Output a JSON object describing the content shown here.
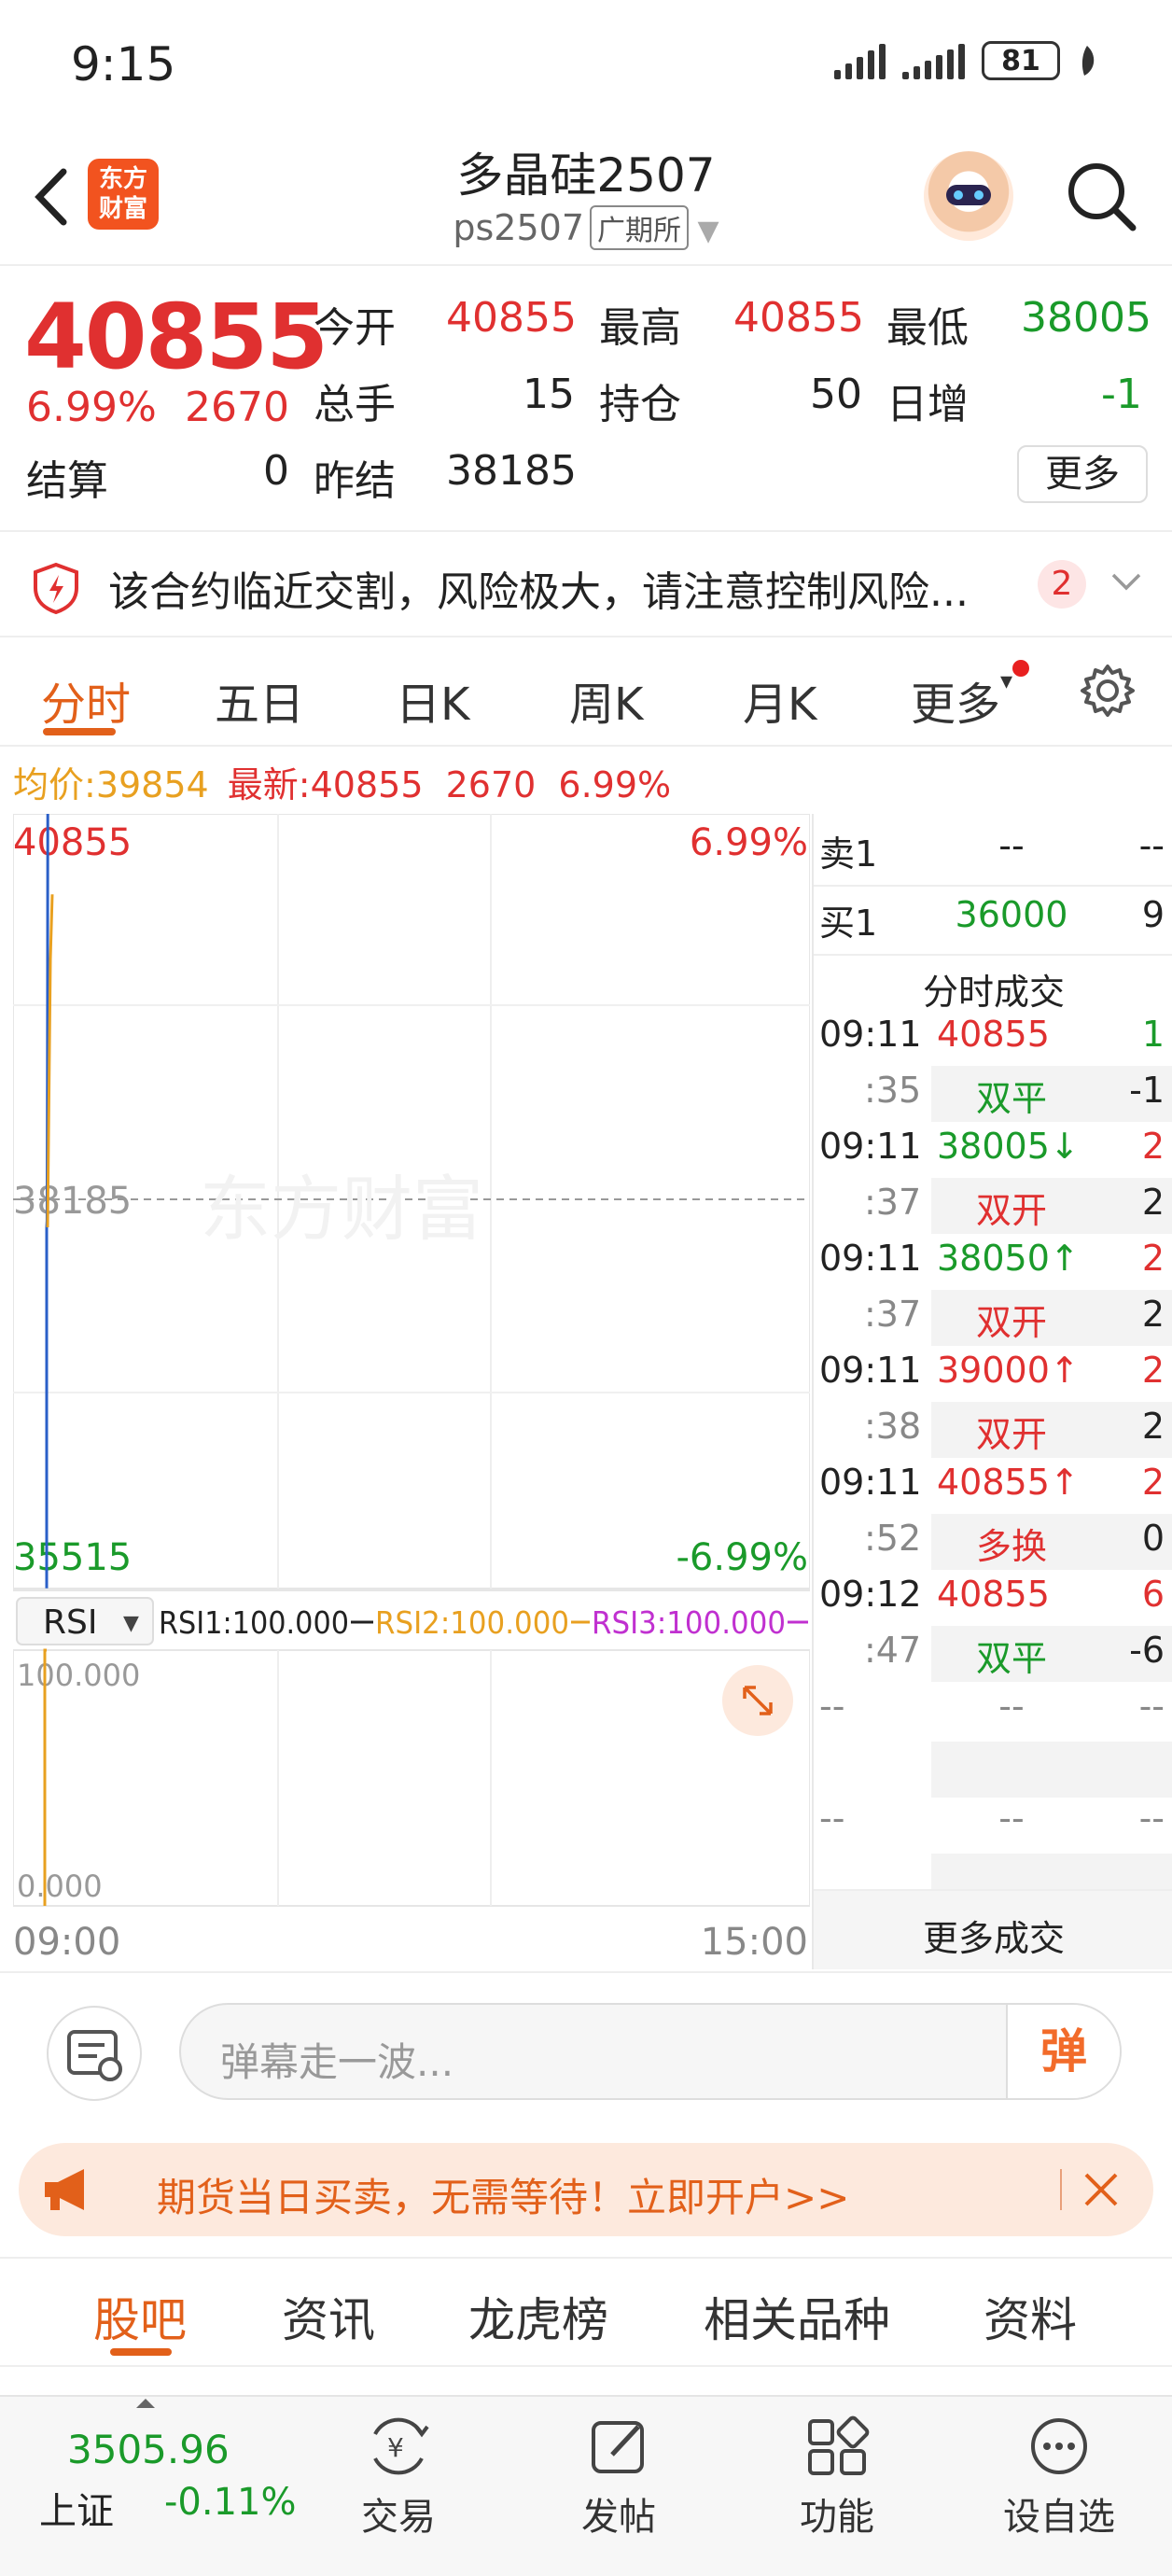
{
  "status": {
    "time": "9:15",
    "battery": "81"
  },
  "header": {
    "title": "多晶硅2507",
    "code": "ps2507",
    "exchange": "广期所",
    "logo_line1": "东方",
    "logo_line2": "财富"
  },
  "quote": {
    "price": "40855",
    "change_pct": "6.99%",
    "change": "2670",
    "open_label": "今开",
    "open": "40855",
    "high_label": "最高",
    "high": "40855",
    "low_label": "最低",
    "low": "38005",
    "volume_label": "总手",
    "volume": "15",
    "oi_label": "持仓",
    "oi": "50",
    "daily_inc_label": "日增",
    "daily_inc": "-1",
    "settle_label": "结算",
    "settle": "0",
    "prev_settle_label": "昨结",
    "prev_settle": "38185",
    "more_label": "更多"
  },
  "notice": {
    "text": "该合约临近交割，风险极大，请注意控制风险...",
    "count": "2"
  },
  "tabs": [
    "分时",
    "五日",
    "日K",
    "周K",
    "月K",
    "更多"
  ],
  "infoline": {
    "avg_label": "均价:",
    "avg": "39854",
    "latest_label": "最新:",
    "latest": "40855",
    "change": "2670",
    "pct": "6.99%"
  },
  "chart": {
    "upper_price": "40855",
    "upper_pct": "6.99%",
    "mid_price": "38185",
    "lower_price": "35515",
    "lower_pct": "-6.99%",
    "watermark": "东方财富",
    "indicator": "RSI",
    "rsi1": "RSI1:100.000",
    "rsi2": "RSI2:100.000",
    "rsi3": "RSI3:100.000",
    "rsi_top": "100.000",
    "rsi_bottom": "0.000",
    "time_start": "09:00",
    "time_end": "15:00"
  },
  "chart_data": {
    "type": "line",
    "x_range": [
      "09:00",
      "15:00"
    ],
    "ylim": [
      35515,
      40855
    ],
    "baseline": 38185,
    "series": [
      {
        "name": "",
        "x": [
          "09:11",
          "09:11",
          "09:11",
          "09:11",
          "09:12"
        ],
        "values": [
          38005,
          38050,
          39000,
          40855,
          40855
        ]
      }
    ],
    "rsi": {
      "ylim": [
        0,
        100
      ],
      "values": [
        0,
        100
      ]
    }
  },
  "orderbook": {
    "ask_label": "卖1",
    "ask_price": "--",
    "ask_qty": "--",
    "bid_label": "买1",
    "bid_price": "36000",
    "bid_qty": "9"
  },
  "trades_title": "分时成交",
  "trades": [
    {
      "t": "09:11",
      "price": "40855",
      "arrow": "",
      "qty": "1",
      "sec": ":35",
      "type": "双平",
      "chg": "-1"
    },
    {
      "t": "09:11",
      "price": "38005",
      "arrow": "↓",
      "qty": "2",
      "sec": ":37",
      "type": "双开",
      "chg": "2"
    },
    {
      "t": "09:11",
      "price": "38050",
      "arrow": "↑",
      "qty": "2",
      "sec": ":37",
      "type": "双开",
      "chg": "2"
    },
    {
      "t": "09:11",
      "price": "39000",
      "arrow": "↑",
      "qty": "2",
      "sec": ":38",
      "type": "双开",
      "chg": "2"
    },
    {
      "t": "09:11",
      "price": "40855",
      "arrow": "↑",
      "qty": "2",
      "sec": ":52",
      "type": "多换",
      "chg": "0"
    },
    {
      "t": "09:12",
      "price": "40855",
      "arrow": "",
      "qty": "6",
      "sec": ":47",
      "type": "双平",
      "chg": "-6"
    }
  ],
  "empty_cell": "--",
  "more_trades": "更多成交",
  "danmaku": {
    "placeholder": "弹幕走一波...",
    "button": "弹"
  },
  "banner": {
    "text": "期货当日买卖，无需等待！立即开户>>"
  },
  "bottom_tabs": [
    "股吧",
    "资讯",
    "龙虎榜",
    "相关品种",
    "资料"
  ],
  "index": {
    "value": "3505.96",
    "name": "上证",
    "change": "-0.11%"
  },
  "nav": [
    "交易",
    "发帖",
    "功能",
    "设自选"
  ],
  "colors": {
    "up": "#e03030",
    "down": "#1a9a2a",
    "accent": "#e2601a",
    "avg": "#e8a020",
    "price_line": "#2a5fc8"
  }
}
